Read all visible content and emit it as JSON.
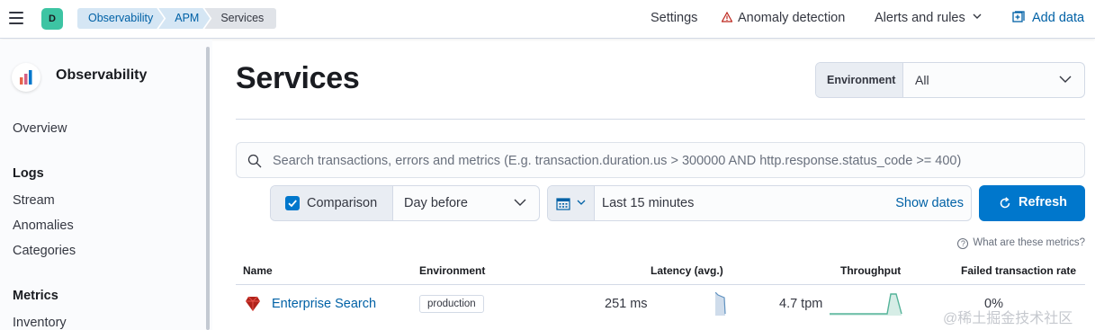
{
  "header": {
    "avatar_letter": "D",
    "breadcrumbs": [
      "Observability",
      "APM",
      "Services"
    ],
    "nav": {
      "settings": "Settings",
      "anomaly": "Anomaly detection",
      "alerts": "Alerts and rules",
      "add_data": "Add data"
    }
  },
  "sidebar": {
    "title": "Observability",
    "overview": "Overview",
    "sections": [
      {
        "heading": "Logs",
        "items": [
          "Stream",
          "Anomalies",
          "Categories"
        ]
      },
      {
        "heading": "Metrics",
        "items": [
          "Inventory"
        ]
      }
    ]
  },
  "main": {
    "title": "Services",
    "environment": {
      "label": "Environment",
      "value": "All"
    },
    "search_placeholder": "Search transactions, errors and metrics (E.g. transaction.duration.us > 300000 AND http.response.status_code >= 400)",
    "comparison": {
      "label": "Comparison",
      "checked": true,
      "value": "Day before"
    },
    "date": {
      "value": "Last 15 minutes",
      "show_dates": "Show dates"
    },
    "refresh": "Refresh",
    "help": "What are these metrics?",
    "table": {
      "headers": [
        "Name",
        "Environment",
        "Latency (avg.)",
        "Throughput",
        "Failed transaction rate"
      ],
      "rows": [
        {
          "name": "Enterprise Search",
          "environment": "production",
          "latency": "251 ms",
          "throughput": "4.7 tpm",
          "failed_rate": "0%"
        }
      ]
    }
  },
  "watermark": "@稀土掘金技术社区",
  "colors": {
    "primary": "#0077cc",
    "link": "#0061a6",
    "accent_avatar": "#3dc4a3",
    "spark_green": "#54b399",
    "spark_blue": "#6092c0"
  }
}
